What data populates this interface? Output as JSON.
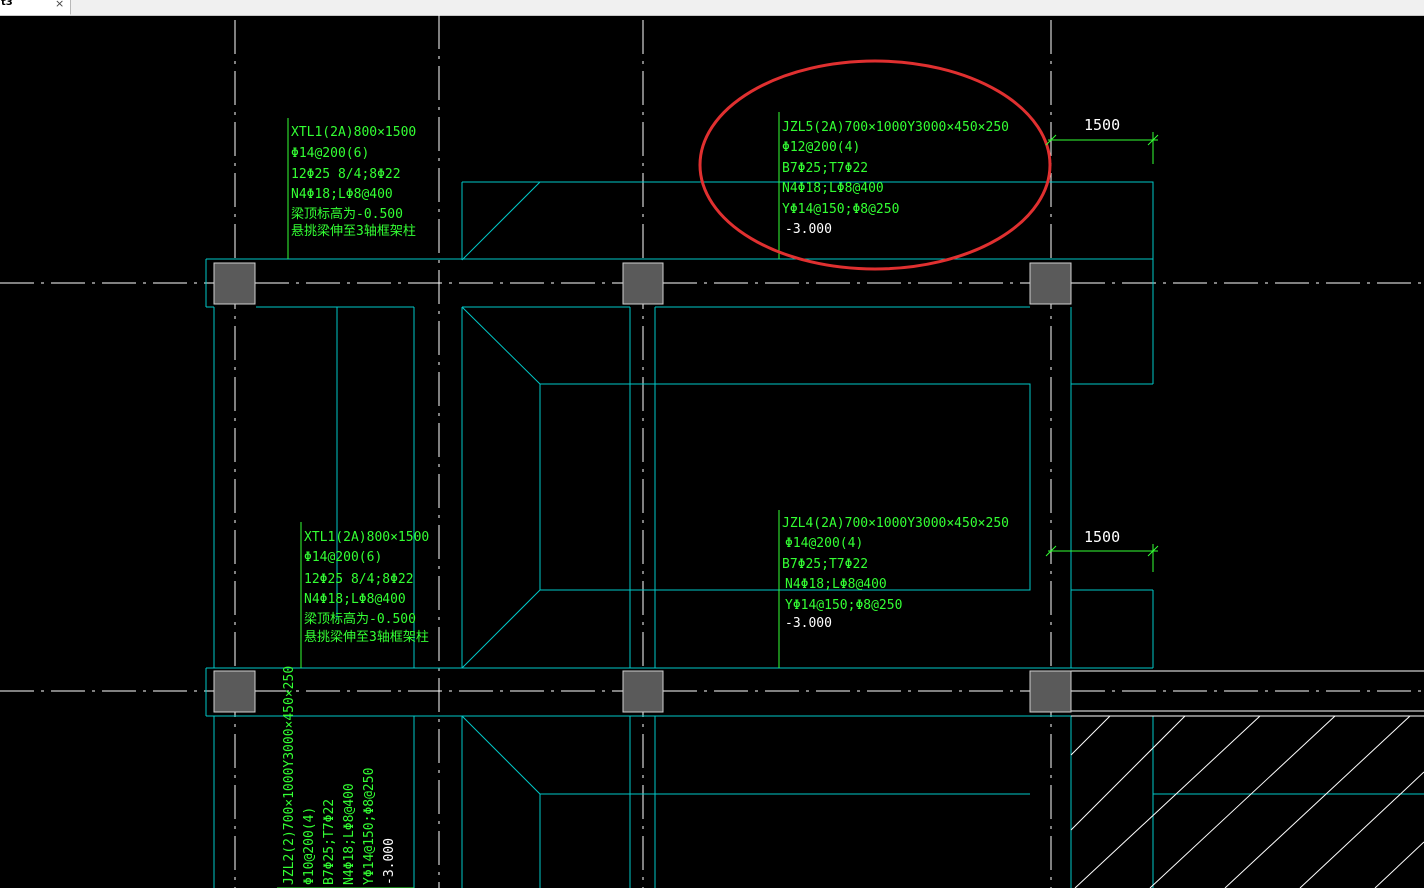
{
  "tab": {
    "label": "t3",
    "close": "×"
  },
  "colors": {
    "background": "#000000",
    "beam": "#00c8c8",
    "axis": "#ffffff",
    "annotation": "#33ff33",
    "column": "#5a5a5a",
    "highlight": "#e03030"
  },
  "beams": {
    "xtl1_top": [
      "XTL1(2A)800×1500",
      "Φ14@200(6)",
      "12Φ25 8/4;8Φ22",
      "N4Φ18;LΦ8@400",
      "梁顶标高为-0.500",
      "悬挑梁伸至3轴框架柱"
    ],
    "jzl5": [
      "JZL5(2A)700×1000Y3000×450×250",
      "Φ12@200(4)",
      "B7Φ25;T7Φ22",
      "N4Φ18;LΦ8@400",
      "YΦ14@150;Φ8@250",
      "-3.000"
    ],
    "xtl1_mid": [
      "XTL1(2A)800×1500",
      "Φ14@200(6)",
      "12Φ25 8/4;8Φ22",
      "N4Φ18;LΦ8@400",
      "梁顶标高为-0.500",
      "悬挑梁伸至3轴框架柱"
    ],
    "jzl4": [
      "JZL4(2A)700×1000Y3000×450×250",
      "Φ14@200(4)",
      "B7Φ25;T7Φ22",
      "N4Φ18;LΦ8@400",
      "YΦ14@150;Φ8@250",
      "-3.000"
    ],
    "jzl2": [
      "JZL2(2)700×1000Y3000×450×250",
      "Φ10@200(4)",
      "B7Φ25;T7Φ22",
      "N4Φ18;LΦ8@400",
      "YΦ14@150;Φ8@250",
      "-3.000"
    ]
  },
  "dimensions": {
    "top": "1500",
    "middle": "1500"
  }
}
